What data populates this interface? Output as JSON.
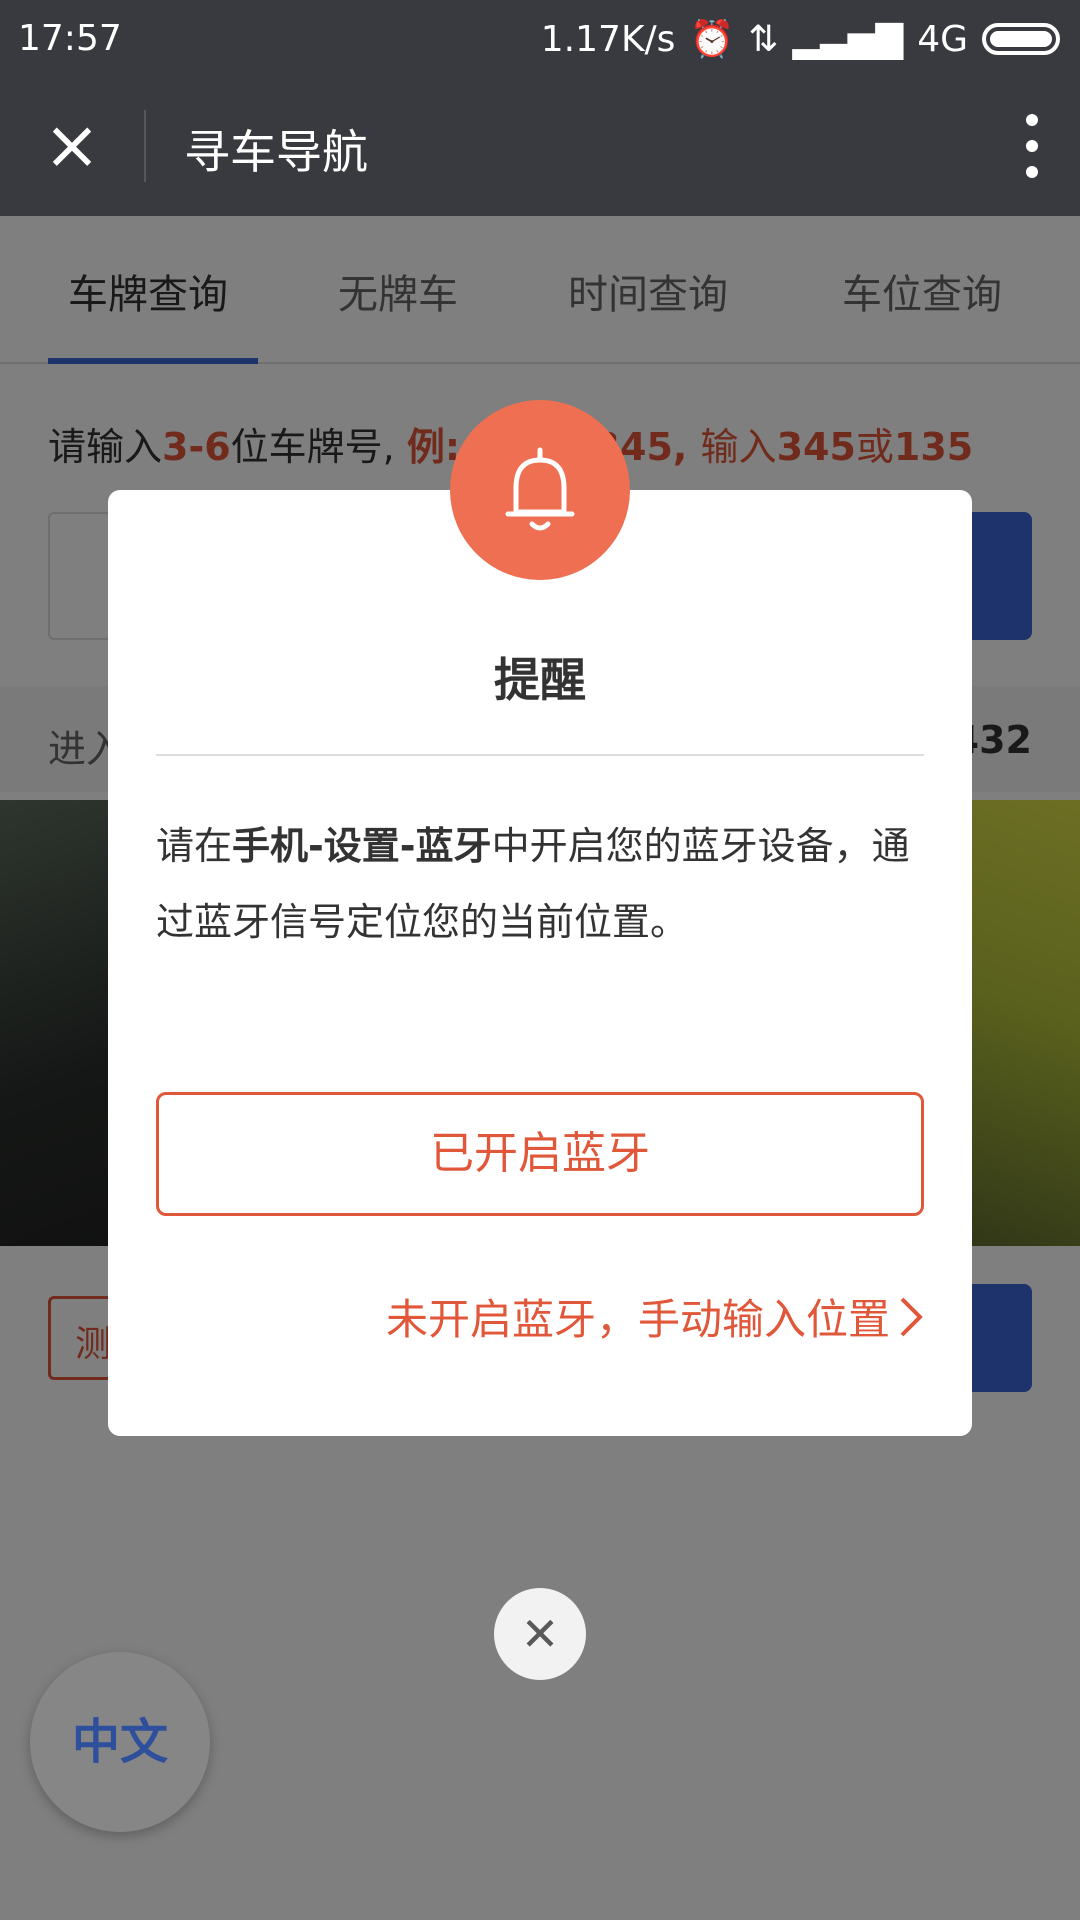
{
  "status_bar": {
    "time": "17:57",
    "network_speed": "1.17K/s",
    "network_type": "4G"
  },
  "header": {
    "title": "寻车导航"
  },
  "tabs": [
    {
      "label": "车牌查询"
    },
    {
      "label": "无牌车"
    },
    {
      "label": "时间查询"
    },
    {
      "label": "车位查询"
    }
  ],
  "search": {
    "hint_prefix": "请输入",
    "hint_digits": "3-6",
    "hint_mid": "位车牌号, ",
    "hint_example": "例: 粤A12345, ",
    "hint_input": "输入",
    "hint_345": "345",
    "hint_or": "或",
    "hint_135": "135",
    "input_value": "",
    "strip_left": "进入",
    "strip_right": "432",
    "test_button": "测试"
  },
  "dialog": {
    "title": "提醒",
    "message_prefix": "请在",
    "message_bold": "手机-设置-蓝牙",
    "message_suffix": "中开启您的蓝牙设备，通过蓝牙信号定位您的当前位置。",
    "primary_button": "已开启蓝牙",
    "secondary_link": "未开启蓝牙，手动输入位置"
  },
  "language_button": "中文"
}
